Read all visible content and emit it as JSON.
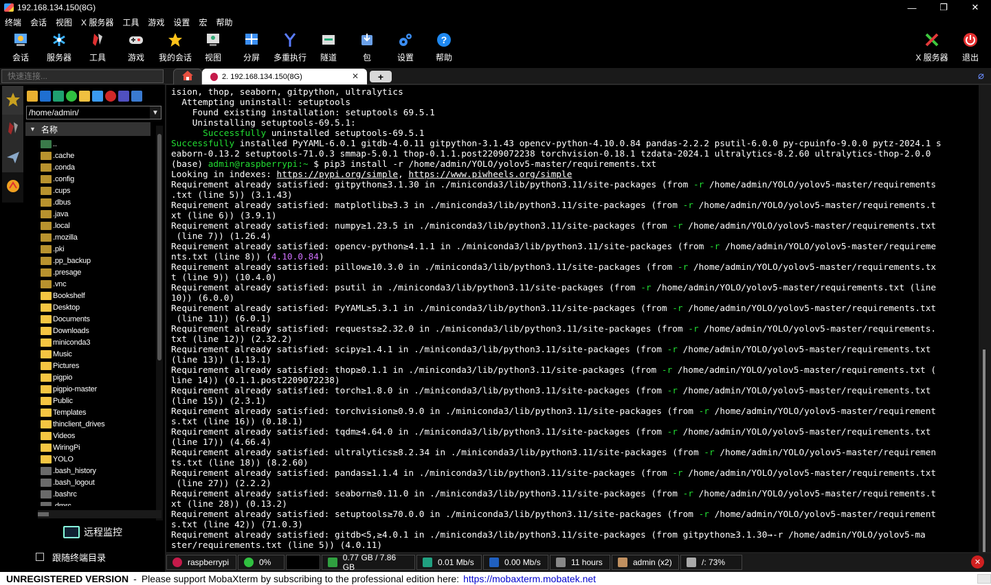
{
  "window": {
    "title": "192.168.134.150(8G)",
    "min": "—",
    "max": "❐",
    "close": "✕"
  },
  "menu": [
    "终端",
    "会话",
    "视图",
    "X 服务器",
    "工具",
    "游戏",
    "设置",
    "宏",
    "帮助"
  ],
  "toolbar": {
    "items": [
      "会话",
      "服务器",
      "工具",
      "游戏",
      "我的会话",
      "视图",
      "分屏",
      "多重执行",
      "隧道",
      "包",
      "设置",
      "帮助"
    ],
    "right": [
      "X 服务器",
      "退出"
    ]
  },
  "quick_connect": {
    "placeholder": "快速连接..."
  },
  "tabs": {
    "active_label": "2. 192.168.134.150(8G)",
    "close": "✕",
    "new": "+"
  },
  "sidebar": {
    "path": "/home/admin/",
    "column": "名称",
    "files": [
      "..",
      ".cache",
      ".conda",
      ".config",
      ".cups",
      ".dbus",
      ".java",
      ".local",
      ".mozilla",
      ".pki",
      ".pp_backup",
      ".presage",
      ".vnc",
      "Bookshelf",
      "Desktop",
      "Documents",
      "Downloads",
      "miniconda3",
      "Music",
      "Pictures",
      "pigpio",
      "pigpio-master",
      "Public",
      "Templates",
      "thinclient_drives",
      "Videos",
      "WiringPi",
      "YOLO",
      ".bash_history",
      ".bash_logout",
      ".bashrc",
      ".dmrc"
    ],
    "monitor": "远程监控",
    "follow": "跟随终端目录"
  },
  "terminal": {
    "lines": [
      "ision, thop, seaborn, gitpython, ultralytics",
      "  Attempting uninstall: setuptools",
      "    Found existing installation: setuptools 69.5.1",
      "    Uninstalling setuptools-69.5.1:",
      "      Successfully uninstalled setuptools-69.5.1",
      "Successfully installed PyYAML-6.0.1 gitdb-4.0.11 gitpython-3.1.43 opencv-python-4.10.0.84 pandas-2.2.2 psutil-6.0.0 py-cpuinfo-9.0.0 pytz-2024.1 s",
      "eaborn-0.13.2 setuptools-71.0.3 smmap-5.0.1 thop-0.1.1.post2209072238 torchvision-0.18.1 tzdata-2024.1 ultralytics-8.2.60 ultralytics-thop-2.0.0",
      "(base) admin@raspberrypi:~ $ pip3 install -r /home/admin/YOLO/yolov5-master/requirements.txt",
      "Looking in indexes: https://pypi.org/simple, https://www.piwheels.org/simple",
      "Requirement already satisfied: gitpython≥3.1.30 in ./miniconda3/lib/python3.11/site-packages (from -r /home/admin/YOLO/yolov5-master/requirements",
      ".txt (line 5)) (3.1.43)",
      "Requirement already satisfied: matplotlib≥3.3 in ./miniconda3/lib/python3.11/site-packages (from -r /home/admin/YOLO/yolov5-master/requirements.t",
      "xt (line 6)) (3.9.1)",
      "Requirement already satisfied: numpy≥1.23.5 in ./miniconda3/lib/python3.11/site-packages (from -r /home/admin/YOLO/yolov5-master/requirements.txt",
      " (line 7)) (1.26.4)",
      "Requirement already satisfied: opencv-python≥4.1.1 in ./miniconda3/lib/python3.11/site-packages (from -r /home/admin/YOLO/yolov5-master/requireme",
      "nts.txt (line 8)) (4.10.0.84)",
      "Requirement already satisfied: pillow≥10.3.0 in ./miniconda3/lib/python3.11/site-packages (from -r /home/admin/YOLO/yolov5-master/requirements.tx",
      "t (line 9)) (10.4.0)",
      "Requirement already satisfied: psutil in ./miniconda3/lib/python3.11/site-packages (from -r /home/admin/YOLO/yolov5-master/requirements.txt (line",
      "10)) (6.0.0)",
      "Requirement already satisfied: PyYAML≥5.3.1 in ./miniconda3/lib/python3.11/site-packages (from -r /home/admin/YOLO/yolov5-master/requirements.txt",
      " (line 11)) (6.0.1)",
      "Requirement already satisfied: requests≥2.32.0 in ./miniconda3/lib/python3.11/site-packages (from -r /home/admin/YOLO/yolov5-master/requirements.",
      "txt (line 12)) (2.32.2)",
      "Requirement already satisfied: scipy≥1.4.1 in ./miniconda3/lib/python3.11/site-packages (from -r /home/admin/YOLO/yolov5-master/requirements.txt",
      "(line 13)) (1.13.1)",
      "Requirement already satisfied: thop≥0.1.1 in ./miniconda3/lib/python3.11/site-packages (from -r /home/admin/YOLO/yolov5-master/requirements.txt (",
      "line 14)) (0.1.1.post2209072238)",
      "Requirement already satisfied: torch≥1.8.0 in ./miniconda3/lib/python3.11/site-packages (from -r /home/admin/YOLO/yolov5-master/requirements.txt",
      "(line 15)) (2.3.1)",
      "Requirement already satisfied: torchvision≥0.9.0 in ./miniconda3/lib/python3.11/site-packages (from -r /home/admin/YOLO/yolov5-master/requirement",
      "s.txt (line 16)) (0.18.1)",
      "Requirement already satisfied: tqdm≥4.64.0 in ./miniconda3/lib/python3.11/site-packages (from -r /home/admin/YOLO/yolov5-master/requirements.txt",
      "(line 17)) (4.66.4)",
      "Requirement already satisfied: ultralytics≥8.2.34 in ./miniconda3/lib/python3.11/site-packages (from -r /home/admin/YOLO/yolov5-master/requiremen",
      "ts.txt (line 18)) (8.2.60)",
      "Requirement already satisfied: pandas≥1.1.4 in ./miniconda3/lib/python3.11/site-packages (from -r /home/admin/YOLO/yolov5-master/requirements.txt",
      " (line 27)) (2.2.2)",
      "Requirement already satisfied: seaborn≥0.11.0 in ./miniconda3/lib/python3.11/site-packages (from -r /home/admin/YOLO/yolov5-master/requirements.t",
      "xt (line 28)) (0.13.2)",
      "Requirement already satisfied: setuptools≥70.0.0 in ./miniconda3/lib/python3.11/site-packages (from -r /home/admin/YOLO/yolov5-master/requirement",
      "s.txt (line 42)) (71.0.3)",
      "Requirement already satisfied: gitdb<5,≥4.0.1 in ./miniconda3/lib/python3.11/site-packages (from gitpython≥3.1.30→-r /home/admin/YOLO/yolov5-ma",
      "ster/requirements.txt (line 5)) (4.0.11)"
    ]
  },
  "status": {
    "host": "raspberrypi",
    "cpu": "0%",
    "mem": "0.77 GB / 7.86 GB",
    "up": "0.01 Mb/s",
    "down": "0.00 Mb/s",
    "uptime": "11 hours",
    "user": "admin (x2)",
    "disk": "/: 73%"
  },
  "footer": {
    "reg": "UNREGISTERED VERSION",
    "dash": "-",
    "msg": "Please support MobaXterm by subscribing to the professional edition here:",
    "link": "https://mobaxterm.mobatek.net"
  }
}
